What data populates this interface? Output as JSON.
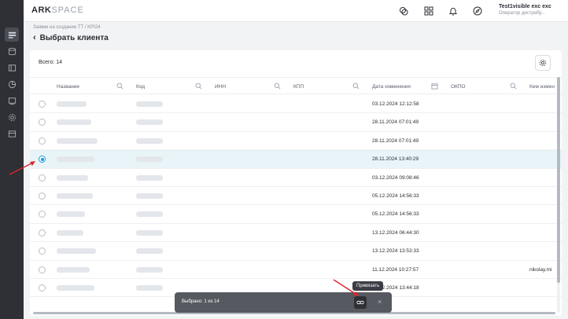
{
  "header": {
    "logo_main": "ARK",
    "logo_accent": "SPACE",
    "user_name": "Test1visible exc exc",
    "user_role": "Оператор дистрибу..."
  },
  "breadcrumb": "Заявки на создание ТТ  /  KPI24",
  "page_title": "Выбрать клиента",
  "total_label": "Всего: 14",
  "columns": [
    "Название",
    "Код",
    "ИНН",
    "КПП",
    "Дата изменения",
    "ОКПО",
    "Кем измен"
  ],
  "rows": [
    {
      "date": "03.12.2024 12:12:58",
      "changed_by": ""
    },
    {
      "date": "28.11.2024 07:01:49",
      "changed_by": ""
    },
    {
      "date": "28.11.2024 07:01:49",
      "changed_by": ""
    },
    {
      "date": "28.11.2024 13:40:29",
      "changed_by": ""
    },
    {
      "date": "03.12.2024 09:08:46",
      "changed_by": ""
    },
    {
      "date": "05.12.2024 14:56:33",
      "changed_by": ""
    },
    {
      "date": "05.12.2024 14:56:33",
      "changed_by": ""
    },
    {
      "date": "13.12.2024 06:44:30",
      "changed_by": ""
    },
    {
      "date": "13.12.2024 13:53:33",
      "changed_by": ""
    },
    {
      "date": "11.12.2024 10:27:57",
      "changed_by": "nikolay.mi"
    },
    {
      "date": "13.12.2024 13:44:18",
      "changed_by": ""
    }
  ],
  "selected_row_index": 3,
  "bottom_bar": {
    "selected_text": "Выбрано: 1 из 14",
    "tooltip": "Привязать",
    "close_glyph": "×"
  },
  "colors": {
    "accent": "#1a9bd7",
    "selected_row": "#e8f4f8",
    "annotation_arrow": "#d9262b"
  }
}
